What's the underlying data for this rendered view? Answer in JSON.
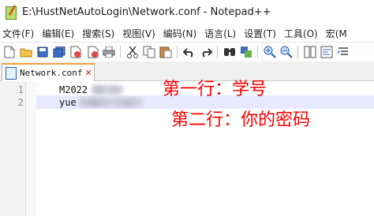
{
  "window": {
    "title": "E:\\HustNetAutoLogin\\Network.conf - Notepad++"
  },
  "menu": {
    "items": [
      "文件(F)",
      "编辑(E)",
      "搜索(S)",
      "视图(V)",
      "编码(N)",
      "语言(L)",
      "设置(T)",
      "工具(O)",
      "宏(M"
    ]
  },
  "toolbar": {
    "buttons": [
      "new-file-icon",
      "open-file-icon",
      "save-icon",
      "save-all-icon",
      "close-icon",
      "close-all-icon",
      "print-icon",
      "cut-icon",
      "copy-icon",
      "paste-icon",
      "undo-icon",
      "redo-icon",
      "find-icon",
      "replace-icon",
      "zoom-in-icon",
      "zoom-out-icon",
      "sync-scroll-icon",
      "word-wrap-icon",
      "indent-guide-icon"
    ]
  },
  "tab": {
    "label": "Network.conf",
    "close": "✕"
  },
  "editor": {
    "lines": [
      {
        "number": "1",
        "text": "M2022"
      },
      {
        "number": "2",
        "text": "yue"
      }
    ]
  },
  "annotations": {
    "first": "第一行：学号",
    "second": "第二行：你的密码"
  },
  "colors": {
    "annotation": "#ff0000",
    "current_line": "#e8e8ff",
    "tab_accent": "#f3a23a"
  }
}
